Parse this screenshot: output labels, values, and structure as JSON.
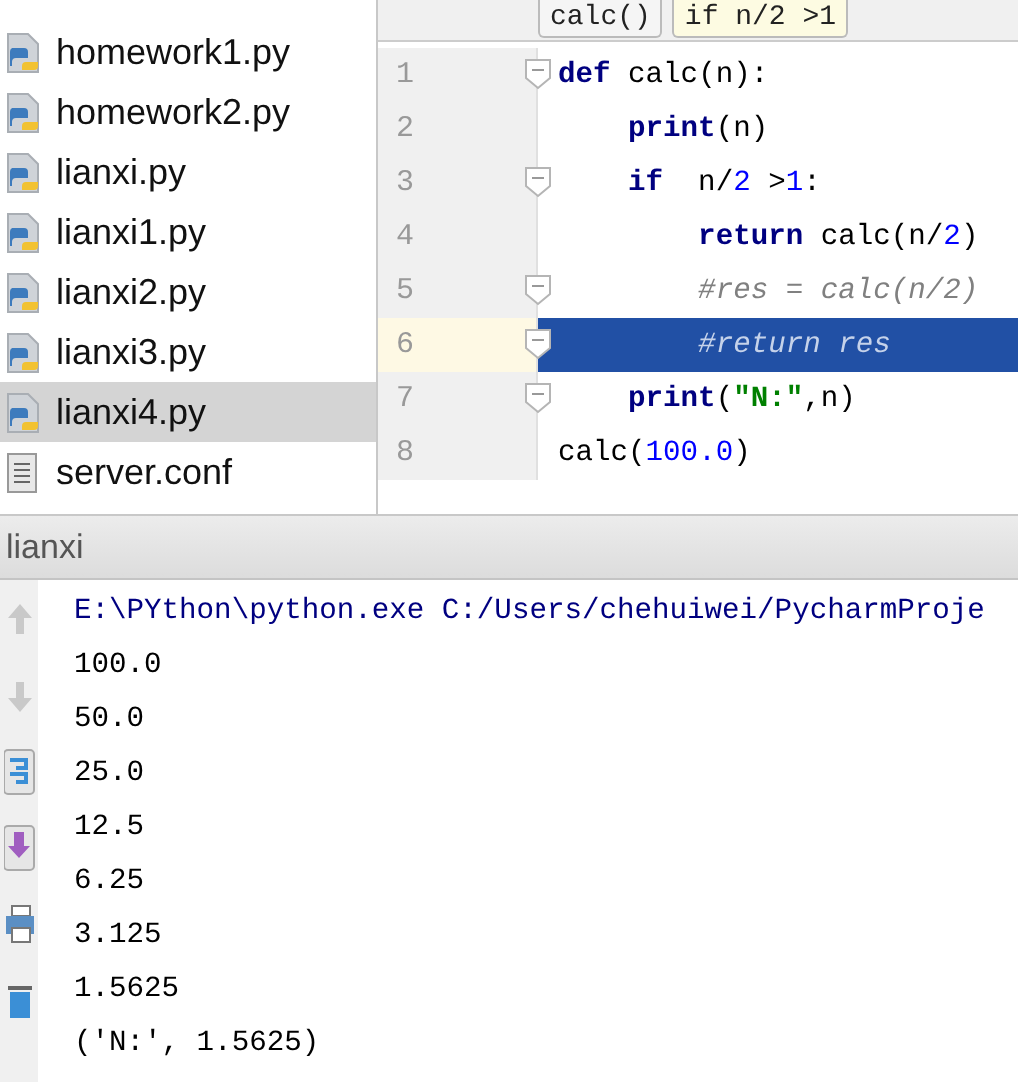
{
  "files": [
    {
      "name": "homework1.py",
      "kind": "python",
      "selected": false
    },
    {
      "name": "homework2.py",
      "kind": "python",
      "selected": false
    },
    {
      "name": "lianxi.py",
      "kind": "python",
      "selected": false
    },
    {
      "name": "lianxi1.py",
      "kind": "python",
      "selected": false
    },
    {
      "name": "lianxi2.py",
      "kind": "python",
      "selected": false
    },
    {
      "name": "lianxi3.py",
      "kind": "python",
      "selected": false
    },
    {
      "name": "lianxi4.py",
      "kind": "python",
      "selected": true
    },
    {
      "name": "server.conf",
      "kind": "text",
      "selected": false
    }
  ],
  "breadcrumbs": [
    {
      "text": "calc()",
      "selected": false
    },
    {
      "text": "if n/2 >1",
      "selected": true
    }
  ],
  "editor": {
    "lines": [
      {
        "number": "1",
        "fold": true,
        "selected": false,
        "tokens": [
          {
            "kind": "kw",
            "text": "def"
          },
          {
            "kind": "plain",
            "text": " calc(n):"
          }
        ]
      },
      {
        "number": "2",
        "fold": false,
        "selected": false,
        "tokens": [
          {
            "kind": "kw",
            "text": "    print"
          },
          {
            "kind": "plain",
            "text": "(n)"
          }
        ]
      },
      {
        "number": "3",
        "fold": true,
        "selected": false,
        "tokens": [
          {
            "kind": "kw",
            "text": "    if"
          },
          {
            "kind": "plain",
            "text": "  n/"
          },
          {
            "kind": "num",
            "text": "2"
          },
          {
            "kind": "plain",
            "text": " >"
          },
          {
            "kind": "num",
            "text": "1"
          },
          {
            "kind": "plain",
            "text": ":"
          }
        ]
      },
      {
        "number": "4",
        "fold": false,
        "selected": false,
        "tokens": [
          {
            "kind": "kw",
            "text": "        return"
          },
          {
            "kind": "plain",
            "text": " calc(n/"
          },
          {
            "kind": "num",
            "text": "2"
          },
          {
            "kind": "plain",
            "text": ")"
          }
        ]
      },
      {
        "number": "5",
        "fold": true,
        "selected": false,
        "tokens": [
          {
            "kind": "comment",
            "text": "        #res = calc(n/2)"
          }
        ]
      },
      {
        "number": "6",
        "fold": true,
        "selected": true,
        "tokens": [
          {
            "kind": "comment",
            "text": "        #return res"
          }
        ]
      },
      {
        "number": "7",
        "fold": true,
        "selected": false,
        "tokens": [
          {
            "kind": "kw",
            "text": "    print"
          },
          {
            "kind": "plain",
            "text": "("
          },
          {
            "kind": "str",
            "text": "\"N:\""
          },
          {
            "kind": "plain",
            "text": ",n)"
          }
        ]
      },
      {
        "number": "8",
        "fold": false,
        "selected": false,
        "tokens": [
          {
            "kind": "plain",
            "text": "calc("
          },
          {
            "kind": "num",
            "text": "100.0"
          },
          {
            "kind": "plain",
            "text": ")"
          }
        ]
      }
    ]
  },
  "run_panel": {
    "title": "lianxi",
    "output": [
      {
        "kind": "command",
        "text": "E:\\PYthon\\python.exe C:/Users/chehuiwei/PycharmProje"
      },
      {
        "kind": "output",
        "text": "100.0"
      },
      {
        "kind": "output",
        "text": "50.0"
      },
      {
        "kind": "output",
        "text": "25.0"
      },
      {
        "kind": "output",
        "text": "12.5"
      },
      {
        "kind": "output",
        "text": "6.25"
      },
      {
        "kind": "output",
        "text": "3.125"
      },
      {
        "kind": "output",
        "text": "1.5625"
      },
      {
        "kind": "output",
        "text": "('N:', 1.5625)"
      }
    ]
  }
}
